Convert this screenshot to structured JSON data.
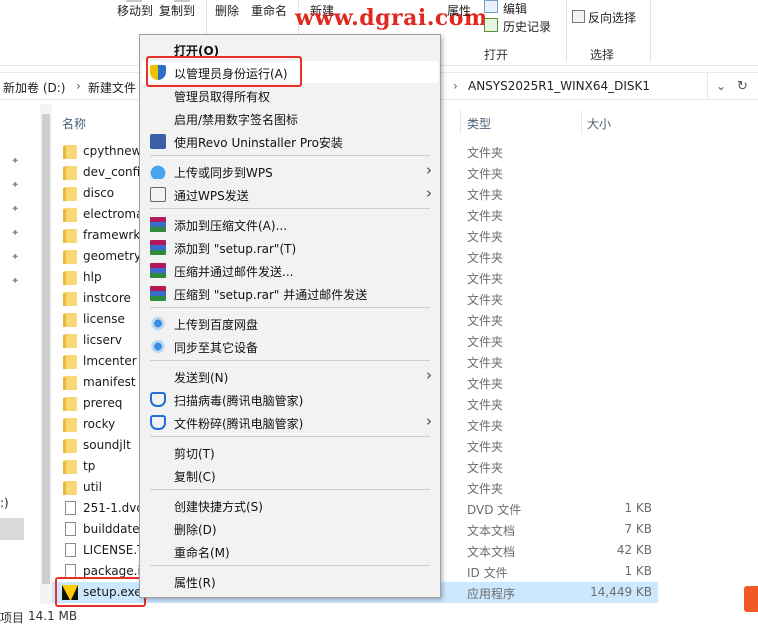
{
  "ribbon": {
    "move_to": "移动到",
    "copy_to": "复制到",
    "delete": "删除",
    "rename": "重命名",
    "new": "新建",
    "properties": "属性",
    "edit": "编辑",
    "history": "历史记录",
    "invert_select": "反向选择",
    "group_open": "打开",
    "group_select": "选择"
  },
  "watermark": "www.dgrai.com",
  "address": {
    "crumb1": "新加卷 (D:)",
    "sep1": "›",
    "crumb2": "新建文件",
    "crumb_last": "ANSYS2025R1_WINX64_DISK1"
  },
  "columns": {
    "name": "名称",
    "type": "类型",
    "size": "大小"
  },
  "files": [
    {
      "name": "cpythnew",
      "type": "文件夹",
      "size": "",
      "kind": "folder"
    },
    {
      "name": "dev_confi",
      "type": "文件夹",
      "size": "",
      "kind": "folder"
    },
    {
      "name": "disco",
      "type": "文件夹",
      "size": "",
      "kind": "folder"
    },
    {
      "name": "electroma",
      "type": "文件夹",
      "size": "",
      "kind": "folder"
    },
    {
      "name": "framewrk",
      "type": "文件夹",
      "size": "",
      "kind": "folder"
    },
    {
      "name": "geometry",
      "type": "文件夹",
      "size": "",
      "kind": "folder"
    },
    {
      "name": "hlp",
      "type": "文件夹",
      "size": "",
      "kind": "folder"
    },
    {
      "name": "instcore",
      "type": "文件夹",
      "size": "",
      "kind": "folder"
    },
    {
      "name": "license",
      "type": "文件夹",
      "size": "",
      "kind": "folder"
    },
    {
      "name": "licserv",
      "type": "文件夹",
      "size": "",
      "kind": "folder"
    },
    {
      "name": "lmcenter",
      "type": "文件夹",
      "size": "",
      "kind": "folder"
    },
    {
      "name": "manifest",
      "type": "文件夹",
      "size": "",
      "kind": "folder"
    },
    {
      "name": "prereq",
      "type": "文件夹",
      "size": "",
      "kind": "folder"
    },
    {
      "name": "rocky",
      "type": "文件夹",
      "size": "",
      "kind": "folder"
    },
    {
      "name": "soundjlt",
      "type": "文件夹",
      "size": "",
      "kind": "folder"
    },
    {
      "name": "tp",
      "type": "文件夹",
      "size": "",
      "kind": "folder"
    },
    {
      "name": "util",
      "type": "文件夹",
      "size": "",
      "kind": "folder"
    },
    {
      "name": "251-1.dvd",
      "type": "DVD 文件",
      "size": "1 KB",
      "kind": "doc"
    },
    {
      "name": "builddate",
      "type": "文本文档",
      "size": "7 KB",
      "kind": "doc"
    },
    {
      "name": "LICENSE.T",
      "type": "文本文档",
      "size": "42 KB",
      "kind": "doc"
    },
    {
      "name": "package.i",
      "type": "ID 文件",
      "size": "1 KB",
      "kind": "doc"
    },
    {
      "name": "setup.exe",
      "type": "应用程序",
      "size": "14,449 KB",
      "kind": "exe"
    }
  ],
  "status": {
    "items_label": "项目",
    "size": "14.1 MB"
  },
  "nav": {
    "drive_fragment": ":)"
  },
  "context_menu": {
    "open": "打开(O)",
    "run_as_admin": "以管理员身份运行(A)",
    "take_ownership": "管理员取得所有权",
    "toggle_signature": "启用/禁用数字签名图标",
    "revo": "使用Revo Uninstaller Pro安装",
    "upload_wps": "上传或同步到WPS",
    "send_wps": "通过WPS发送",
    "add_archive": "添加到压缩文件(A)...",
    "add_setup_rar": "添加到 \"setup.rar\"(T)",
    "compress_email": "压缩并通过邮件发送...",
    "compress_setup_email": "压缩到 \"setup.rar\" 并通过邮件发送",
    "upload_baidu": "上传到百度网盘",
    "sync_devices": "同步至其它设备",
    "send_to": "发送到(N)",
    "scan_virus": "扫描病毒(腾讯电脑管家)",
    "shred": "文件粉碎(腾讯电脑管家)",
    "cut": "剪切(T)",
    "copy": "复制(C)",
    "create_shortcut": "创建快捷方式(S)",
    "delete": "删除(D)",
    "rename": "重命名(M)",
    "properties": "属性(R)",
    "arrow": "›"
  },
  "colors": {
    "selection": "#cce8ff",
    "annotation_red": "#e5302c",
    "watermark": "#e0281f"
  }
}
